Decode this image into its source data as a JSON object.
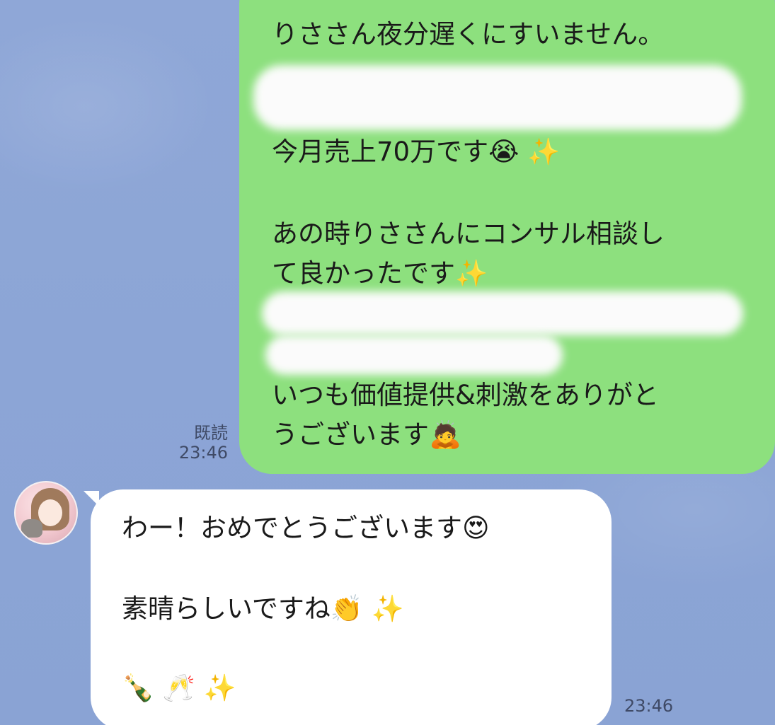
{
  "chat": {
    "sent": {
      "lines": [
        "りささん夜分遅くにすいません。",
        "今月売上70万です😭 ✨",
        "あの時りささんにコンサル相談し",
        "て良かったです✨",
        "いつも価値提供&刺激をありがと",
        "うございます🙇"
      ],
      "read_label": "既読",
      "time": "23:46"
    },
    "received": {
      "lines": [
        "わー！おめでとうございます😍",
        "素晴らしいですね👏 ✨",
        "🍾 🥂 ✨"
      ],
      "time": "23:46"
    }
  },
  "colors": {
    "background": "#8ea6d6",
    "sent_bubble": "#8de07e",
    "received_bubble": "#ffffff",
    "meta_text": "#3f4a66"
  },
  "icons": {
    "avatar": "user-avatar-illustration"
  }
}
